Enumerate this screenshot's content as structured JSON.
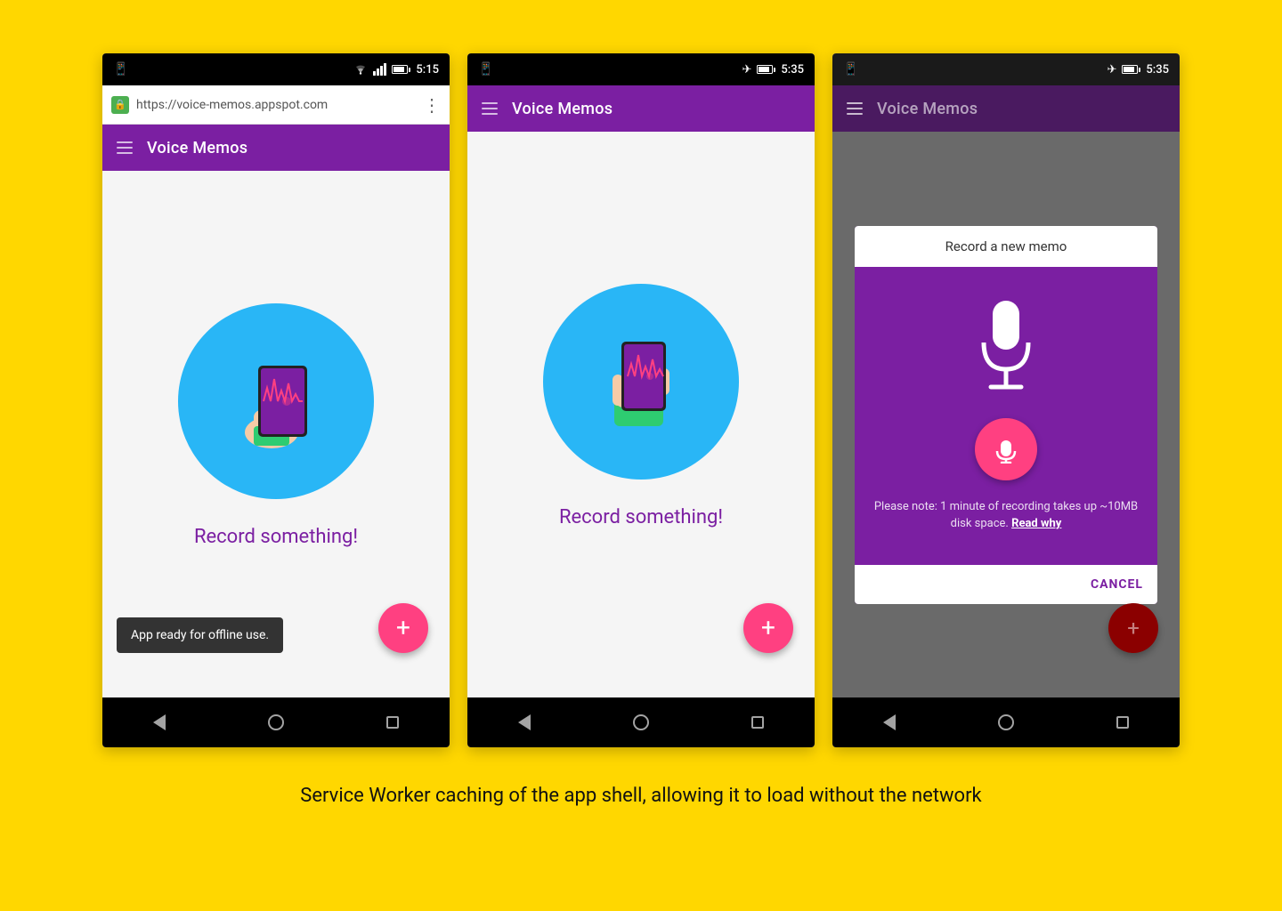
{
  "background": "#FFD700",
  "caption": "Service Worker caching of the app shell, allowing it to load without the network",
  "phones": [
    {
      "id": "phone1",
      "statusBar": {
        "left": "phone-icon",
        "right": "5:15",
        "icons": [
          "wifi",
          "signal",
          "battery"
        ]
      },
      "hasUrlBar": true,
      "urlBar": {
        "url": "https://voice-memos.appspot.com",
        "secureIcon": "🔒"
      },
      "toolbar": {
        "title": "Voice Memos",
        "dimmed": false
      },
      "content": {
        "illustrationText": "Record something!",
        "hasSnackbar": true,
        "snackbarText": "App ready for offline use.",
        "fabLabel": "+"
      }
    },
    {
      "id": "phone2",
      "statusBar": {
        "left": "phone-icon",
        "right": "5:35",
        "icons": [
          "airplane",
          "battery"
        ]
      },
      "hasUrlBar": false,
      "toolbar": {
        "title": "Voice Memos",
        "dimmed": false
      },
      "content": {
        "illustrationText": "Record something!",
        "hasSnackbar": false,
        "fabLabel": "+"
      }
    },
    {
      "id": "phone3",
      "statusBar": {
        "left": "phone-icon",
        "right": "5:35",
        "icons": [
          "airplane",
          "battery"
        ]
      },
      "hasUrlBar": false,
      "toolbar": {
        "title": "Voice Memos",
        "dimmed": true
      },
      "content": {
        "hasDialog": true,
        "dialogTitle": "Record a new memo",
        "dialogNote": "Please note: 1 minute of recording takes up ~10MB disk space.",
        "dialogNoteLink": "Read why",
        "cancelLabel": "CANCEL",
        "fabLabel": "+"
      }
    }
  ]
}
